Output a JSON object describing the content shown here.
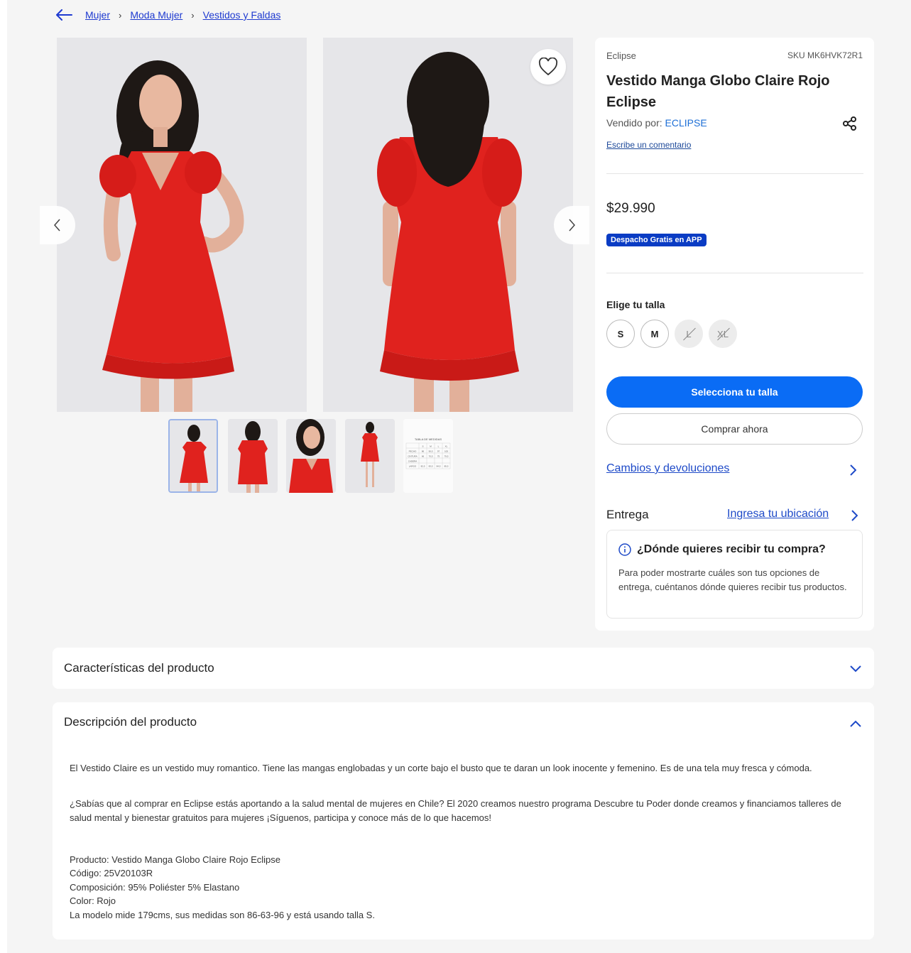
{
  "breadcrumb": {
    "items": [
      "Mujer",
      "Moda Mujer",
      "Vestidos y Faldas"
    ],
    "separator": "›"
  },
  "gallery": {
    "main_images": [
      "Vestido rojo - frente",
      "Vestido rojo - espalda"
    ],
    "thumbnail_count": 5,
    "active_thumbnail": 1,
    "size_chart_thumb": {
      "title": "TABLA DE MEDIDAS",
      "headers": [
        "",
        "S",
        "M",
        "L",
        "XL"
      ],
      "rows": [
        [
          "PECHO",
          "86",
          "90,5",
          "97",
          "105"
        ],
        [
          "CINTURA",
          "66",
          "70,5",
          "75",
          "79,5"
        ],
        [
          "CADERA",
          "",
          "",
          "",
          ""
        ],
        [
          "LARGO",
          "82,5",
          "83,5",
          "84,5",
          "85,5"
        ]
      ]
    }
  },
  "product": {
    "brand": "Eclipse",
    "sku": "SKU MK6HVK72R1",
    "title": "Vestido Manga Globo Claire Rojo Eclipse",
    "sold_by_label": "Vendido por: ",
    "sold_by": "ECLIPSE",
    "review_link": "Escribe un comentario",
    "price": "$29.990",
    "badge": "Despacho Gratis en APP",
    "size_label": "Elige tu talla",
    "sizes": [
      {
        "label": "S",
        "available": true
      },
      {
        "label": "M",
        "available": true
      },
      {
        "label": "L",
        "available": false
      },
      {
        "label": "XL",
        "available": false
      }
    ],
    "primary_button": "Selecciona tu talla",
    "secondary_button": "Comprar ahora",
    "returns_link": "Cambios y devoluciones",
    "delivery_label": "Entrega",
    "location_link": "Ingresa tu ubicación",
    "info_title": "¿Dónde quieres recibir tu compra?",
    "info_text": "Para poder mostrarte cuáles son tus opciones de entrega, cuéntanos dónde quieres recibir tus productos."
  },
  "accordions": {
    "features_title": "Características del producto",
    "description_title": "Descripción del producto",
    "description_paragraphs": [
      "El Vestido Claire es un vestido muy romantico. Tiene las mangas englobadas y un corte bajo el busto que te daran un look inocente y femenino. Es de una tela muy fresca y cómoda.",
      "¿Sabías que al comprar en Eclipse estás aportando a la salud mental de mujeres en Chile? El 2020 creamos nuestro programa Descubre tu Poder donde creamos y financiamos talleres de salud mental y bienestar gratuitos para mujeres ¡Síguenos, participa y conoce más de lo que hacemos!"
    ],
    "specs": [
      "Producto: Vestido Manga Globo Claire Rojo Eclipse",
      "Código: 25V20103R",
      "Composición: 95% Poliéster 5% Elastano",
      "Color: Rojo",
      "La modelo mide 179cms, sus medidas son 86-63-96 y está usando talla S."
    ]
  },
  "colors": {
    "accent": "#0a6cf5",
    "link": "#1e4ac8",
    "badge": "#0a3cc4",
    "dress": "#e0221e"
  }
}
